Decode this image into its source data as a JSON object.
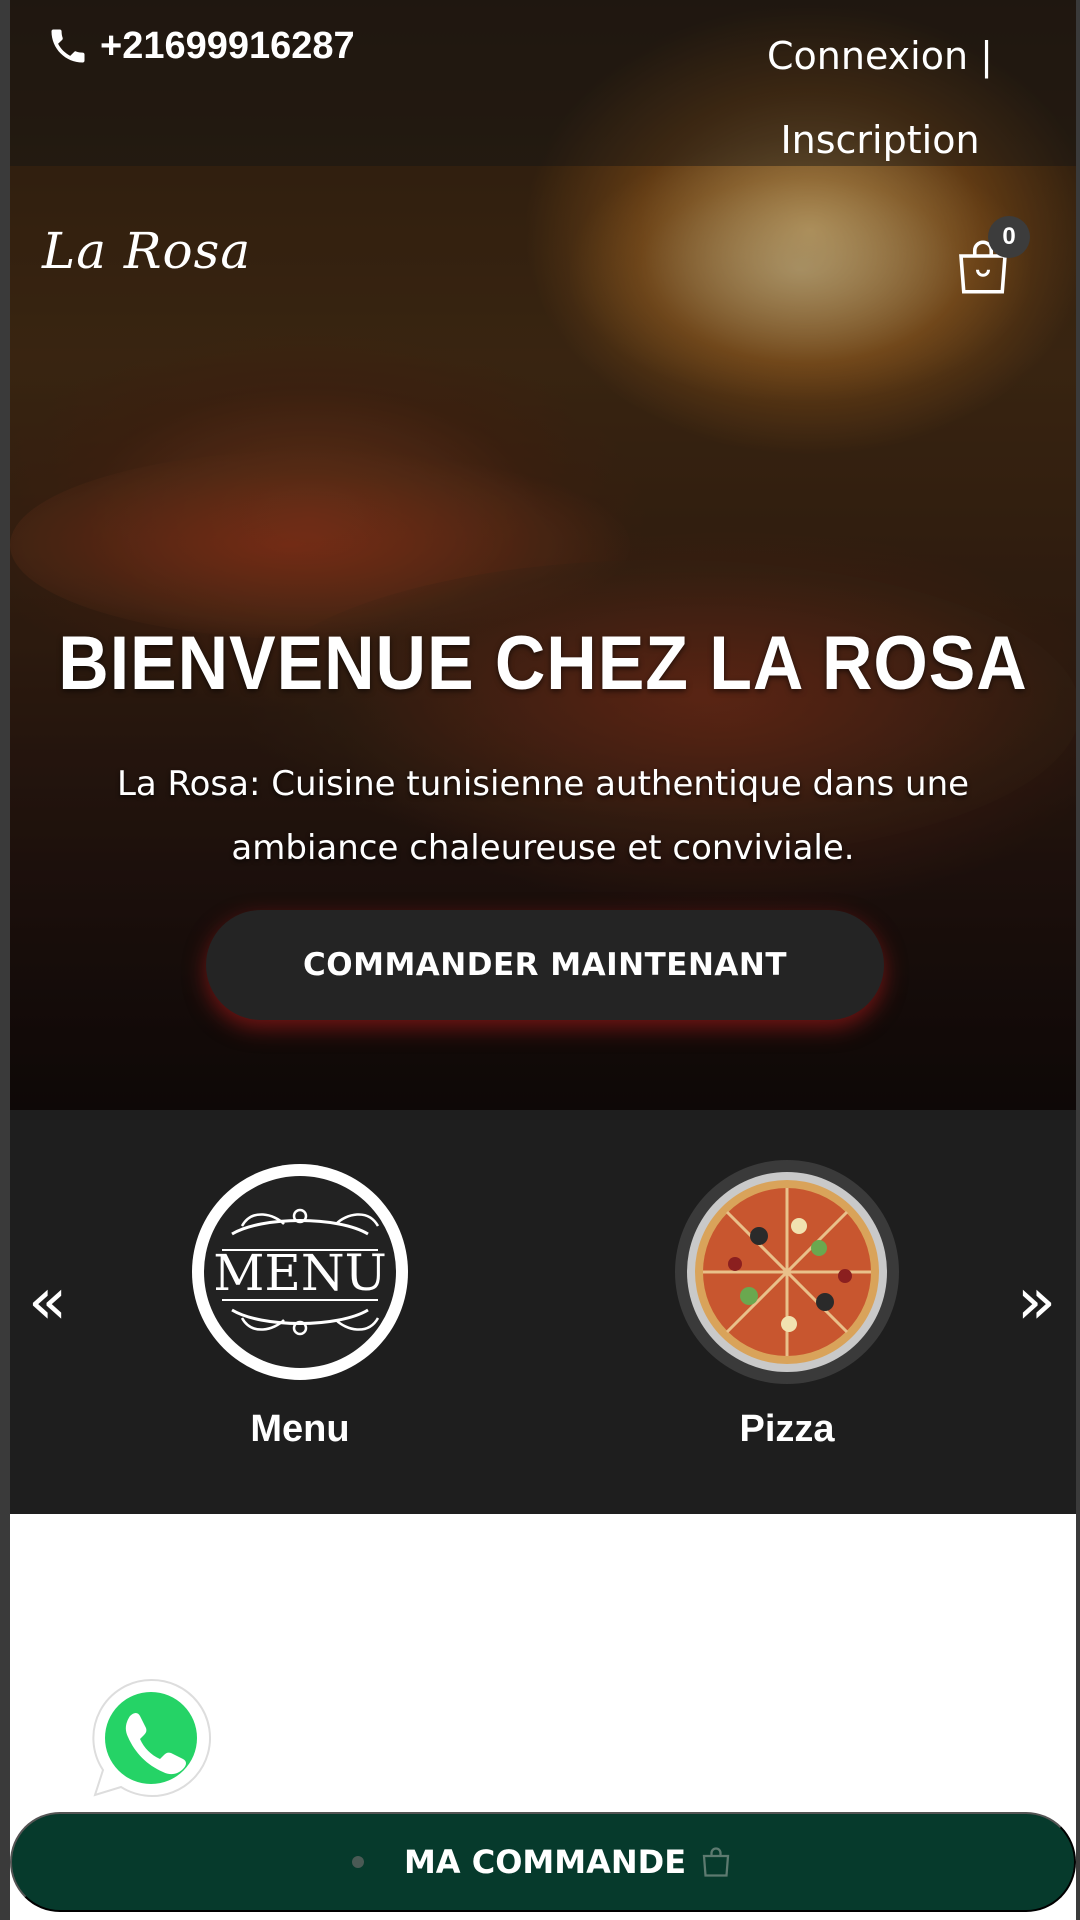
{
  "header": {
    "phone": "+21699916287",
    "auth_links": [
      {
        "label": "Connexion"
      },
      {
        "label": "Inscription"
      }
    ],
    "auth_separator": "|",
    "logo": "La Rosa",
    "cart_count": "0"
  },
  "hero": {
    "title": "BIENVENUE CHEZ LA ROSA",
    "subtitle": "La Rosa: Cuisine tunisienne authentique dans une ambiance chaleureuse et conviviale.",
    "cta_label": "COMMANDER MAINTENANT"
  },
  "categories": {
    "prev_arrow": "«",
    "next_arrow": "»",
    "items": [
      {
        "label": "Menu",
        "image_text": "MENU"
      },
      {
        "label": "Pizza"
      }
    ]
  },
  "footer_bar": {
    "label": "MA COMMANDE"
  },
  "colors": {
    "dark_band": "#1e1e1e",
    "order_bar": "#063a2c",
    "whatsapp": "#25d366"
  },
  "icons": [
    "phone-icon",
    "cart-icon",
    "chevron-left-icon",
    "chevron-right-icon",
    "whatsapp-icon",
    "shopping-bag-icon"
  ]
}
